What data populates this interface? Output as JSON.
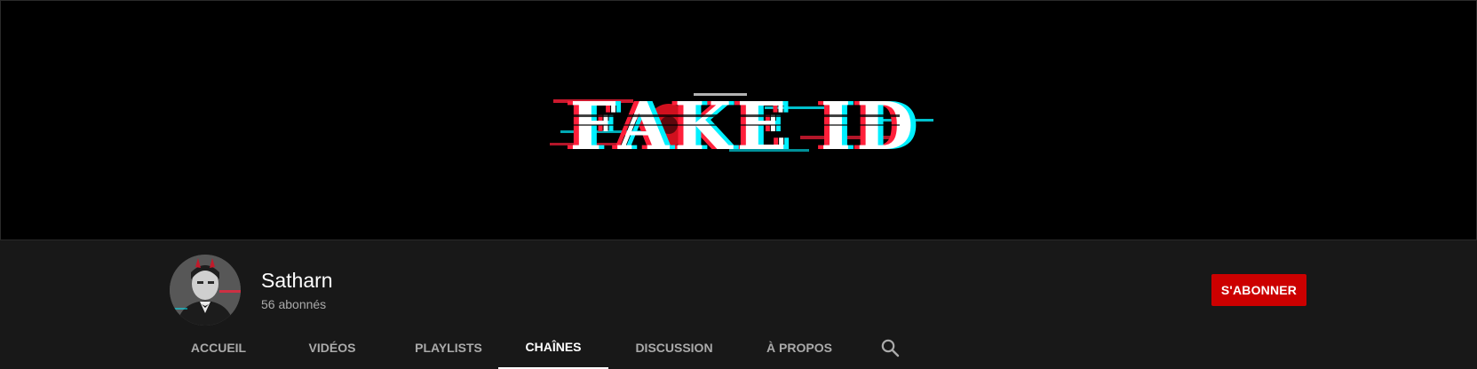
{
  "banner": {
    "logo_text": "FAKE ID"
  },
  "channel": {
    "name": "Satharn",
    "subscribers": "56 abonnés"
  },
  "subscribe_label": "S'ABONNER",
  "tabs": [
    {
      "label": "ACCUEIL",
      "active": false
    },
    {
      "label": "VIDÉOS",
      "active": false
    },
    {
      "label": "PLAYLISTS",
      "active": false
    },
    {
      "label": "CHAÎNES",
      "active": true
    },
    {
      "label": "DISCUSSION",
      "active": false
    },
    {
      "label": "À PROPOS",
      "active": false
    }
  ],
  "icons": {
    "search": "search-icon"
  },
  "colors": {
    "subscribe": "#cc0000",
    "background": "#181818",
    "banner": "#000000",
    "active_tab": "#ffffff",
    "inactive_tab": "#aaaaaa",
    "glitch_cyan": "#00f0ff",
    "glitch_red": "#ff1f3a"
  }
}
